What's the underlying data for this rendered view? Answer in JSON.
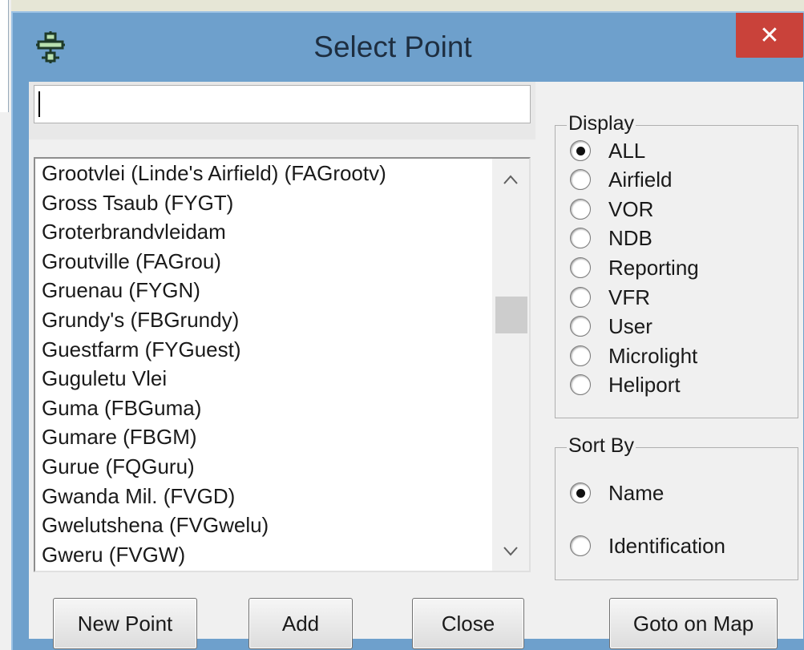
{
  "window": {
    "title": "Select Point",
    "close_glyph": "✕"
  },
  "search": {
    "value": "",
    "placeholder": ""
  },
  "list": {
    "items": [
      "Grootvlei (Linde's Airfield) (FAGrootv)",
      "Gross Tsaub (FYGT)",
      "Groterbrandvleidam",
      "Groutville (FAGrou)",
      "Gruenau (FYGN)",
      "Grundy's (FBGrundy)",
      "Guestfarm (FYGuest)",
      "Guguletu Vlei",
      "Guma (FBGuma)",
      "Gumare (FBGM)",
      "Gurue (FQGuru)",
      "Gwanda Mil. (FVGD)",
      "Gwelutshena (FVGwelu)",
      "Gweru (FVGW)"
    ],
    "scroll_up_glyph": "^",
    "scroll_down_glyph": "v"
  },
  "display_group": {
    "label": "Display",
    "options": [
      {
        "label": "ALL",
        "checked": true
      },
      {
        "label": "Airfield",
        "checked": false
      },
      {
        "label": "VOR",
        "checked": false
      },
      {
        "label": "NDB",
        "checked": false
      },
      {
        "label": "Reporting",
        "checked": false
      },
      {
        "label": "VFR",
        "checked": false
      },
      {
        "label": "User",
        "checked": false
      },
      {
        "label": "Microlight",
        "checked": false
      },
      {
        "label": "Heliport",
        "checked": false
      }
    ]
  },
  "sort_group": {
    "label": "Sort By",
    "options": [
      {
        "label": "Name",
        "checked": true
      },
      {
        "label": "Identification",
        "checked": false
      }
    ]
  },
  "buttons": {
    "new_point": "New Point",
    "add": "Add",
    "close": "Close",
    "goto_map": "Goto on Map"
  },
  "icons": {
    "title_icon": "airplane-icon",
    "close_icon": "close-icon"
  },
  "colors": {
    "title_bar": "#6ea0cc",
    "close_button": "#c9423a"
  }
}
